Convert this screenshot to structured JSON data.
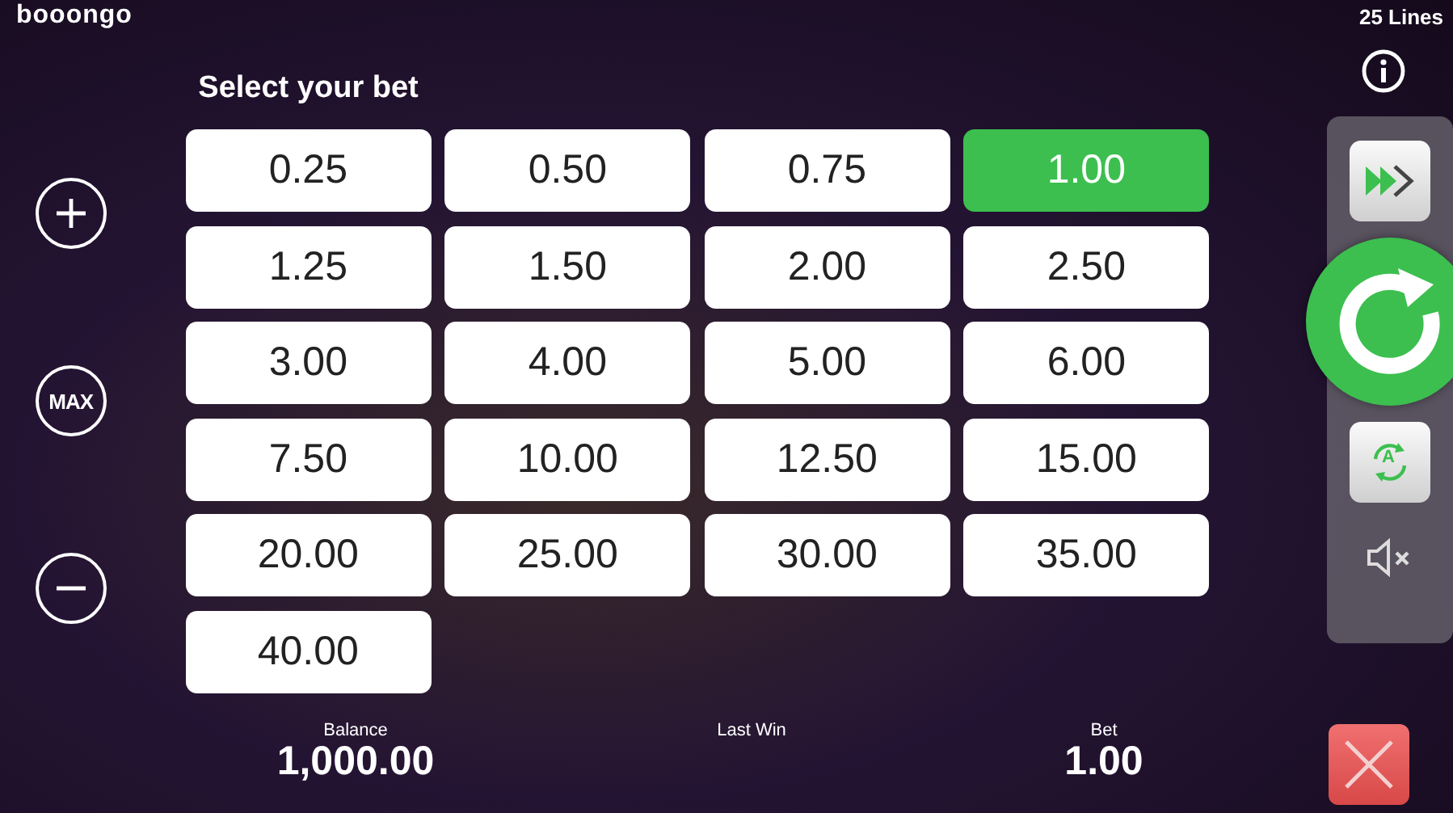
{
  "logo": "booongo",
  "lines_label": "25 Lines",
  "bet_panel": {
    "title": "Select your bet",
    "options": [
      {
        "label": "0.25",
        "selected": false
      },
      {
        "label": "0.50",
        "selected": false
      },
      {
        "label": "0.75",
        "selected": false
      },
      {
        "label": "1.00",
        "selected": true
      },
      {
        "label": "1.25",
        "selected": false
      },
      {
        "label": "1.50",
        "selected": false
      },
      {
        "label": "2.00",
        "selected": false
      },
      {
        "label": "2.50",
        "selected": false
      },
      {
        "label": "3.00",
        "selected": false
      },
      {
        "label": "4.00",
        "selected": false
      },
      {
        "label": "5.00",
        "selected": false
      },
      {
        "label": "6.00",
        "selected": false
      },
      {
        "label": "7.50",
        "selected": false
      },
      {
        "label": "10.00",
        "selected": false
      },
      {
        "label": "12.50",
        "selected": false
      },
      {
        "label": "15.00",
        "selected": false
      },
      {
        "label": "20.00",
        "selected": false
      },
      {
        "label": "25.00",
        "selected": false
      },
      {
        "label": "30.00",
        "selected": false
      },
      {
        "label": "35.00",
        "selected": false
      },
      {
        "label": "40.00",
        "selected": false
      }
    ]
  },
  "left_controls": [
    {
      "kind": "plus"
    },
    {
      "kind": "max",
      "label": "MAX"
    },
    {
      "kind": "minus"
    }
  ],
  "right_controls": [
    {
      "kind": "turbo"
    },
    {
      "kind": "spin"
    },
    {
      "kind": "auto",
      "label": "A"
    },
    {
      "kind": "mute"
    }
  ],
  "status_bar": [
    {
      "label": "Balance",
      "value": "1,000.00"
    },
    {
      "label": "Last Win"
    },
    {
      "label": "Bet",
      "value": "1.00"
    }
  ]
}
